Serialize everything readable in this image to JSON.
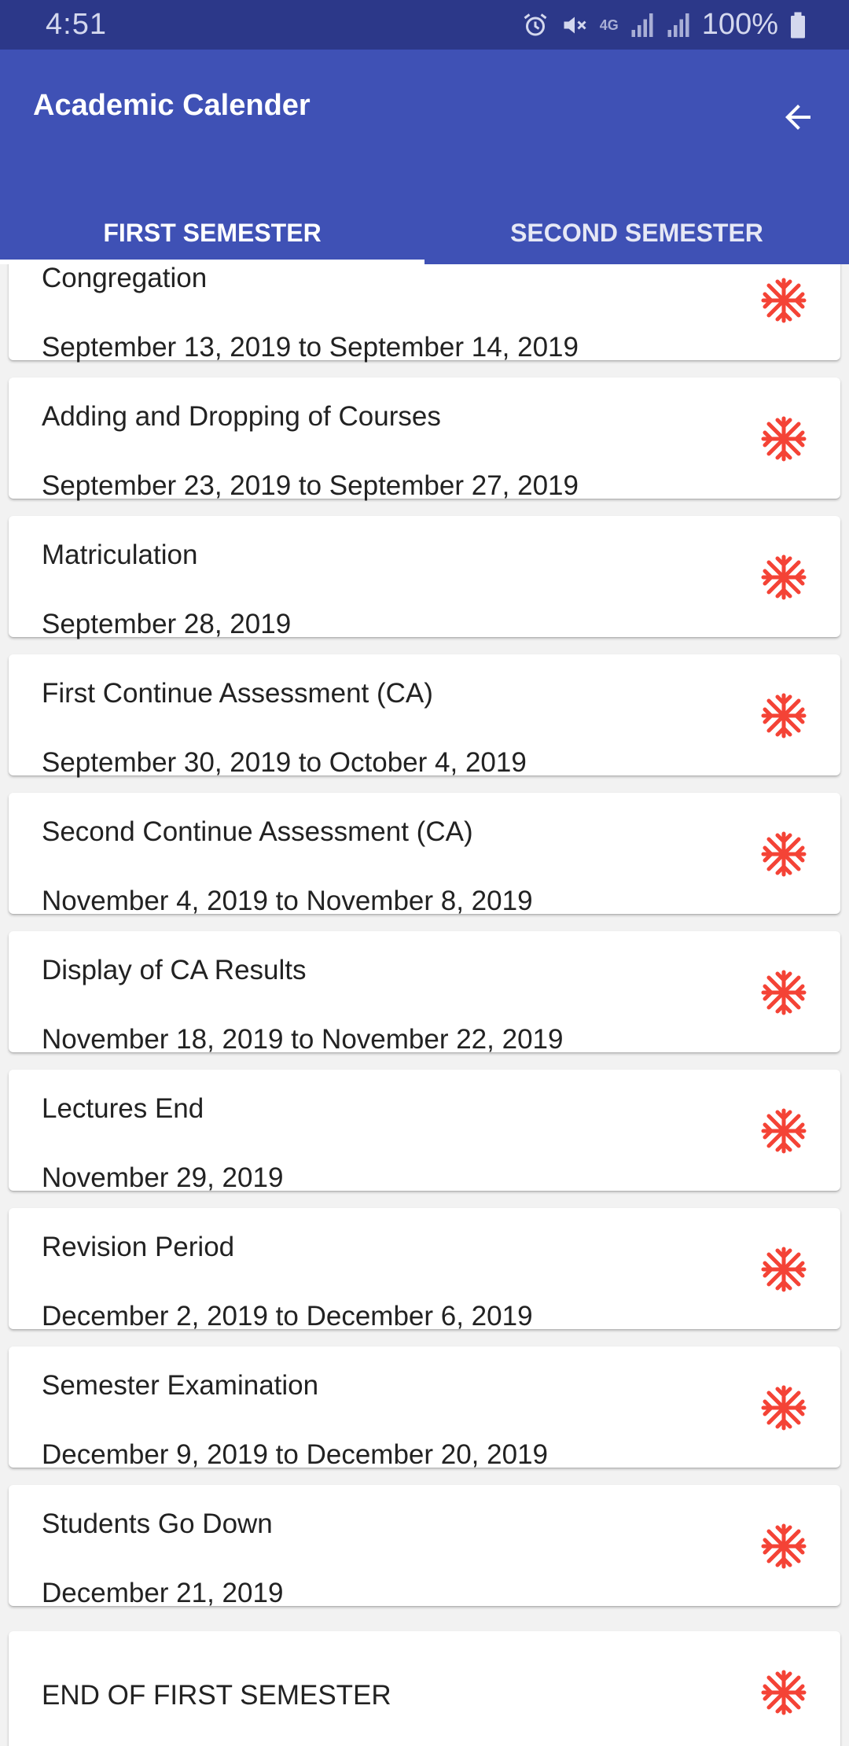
{
  "status_bar": {
    "time": "4:51",
    "network": "4G",
    "battery": "100%",
    "icons": [
      "alarm-icon",
      "mute-icon",
      "network-4g-icon",
      "signal-icon",
      "signal-icon",
      "battery-icon"
    ]
  },
  "app_bar": {
    "title": "Academic Calender",
    "back_icon": "arrow-left-icon"
  },
  "tabs": [
    {
      "label": "FIRST SEMESTER",
      "selected": true
    },
    {
      "label": "SECOND SEMESTER",
      "selected": false
    }
  ],
  "colors": {
    "status_bar": "#2c3889",
    "app_bar": "#3f51b5",
    "accent_icon": "#f44336",
    "card_background": "#ffffff",
    "page_background": "#f2f2f2"
  },
  "events": [
    {
      "title": "Congregation",
      "date": "September 13, 2019 to September 14, 2019",
      "icon": "snowflake-icon"
    },
    {
      "title": "Adding and Dropping of Courses",
      "date": "September 23, 2019 to September 27, 2019",
      "icon": "snowflake-icon"
    },
    {
      "title": "Matriculation",
      "date": "September 28, 2019",
      "icon": "snowflake-icon"
    },
    {
      "title": "First Continue Assessment (CA)",
      "date": "September 30, 2019 to October 4, 2019",
      "icon": "snowflake-icon"
    },
    {
      "title": "Second Continue Assessment (CA)",
      "date": "November 4, 2019 to November 8, 2019",
      "icon": "snowflake-icon"
    },
    {
      "title": "Display of CA Results",
      "date": "November 18, 2019 to November 22, 2019",
      "icon": "snowflake-icon"
    },
    {
      "title": "Lectures End",
      "date": "November 29, 2019",
      "icon": "snowflake-icon"
    },
    {
      "title": "Revision Period",
      "date": "December 2, 2019 to December 6, 2019",
      "icon": "snowflake-icon"
    },
    {
      "title": "Semester Examination",
      "date": "December 9, 2019 to December 20, 2019",
      "icon": "snowflake-icon"
    },
    {
      "title": "Students Go Down",
      "date": "December 21, 2019",
      "icon": "snowflake-icon"
    },
    {
      "title": "END OF FIRST SEMESTER",
      "date": "",
      "icon": "snowflake-icon"
    }
  ]
}
